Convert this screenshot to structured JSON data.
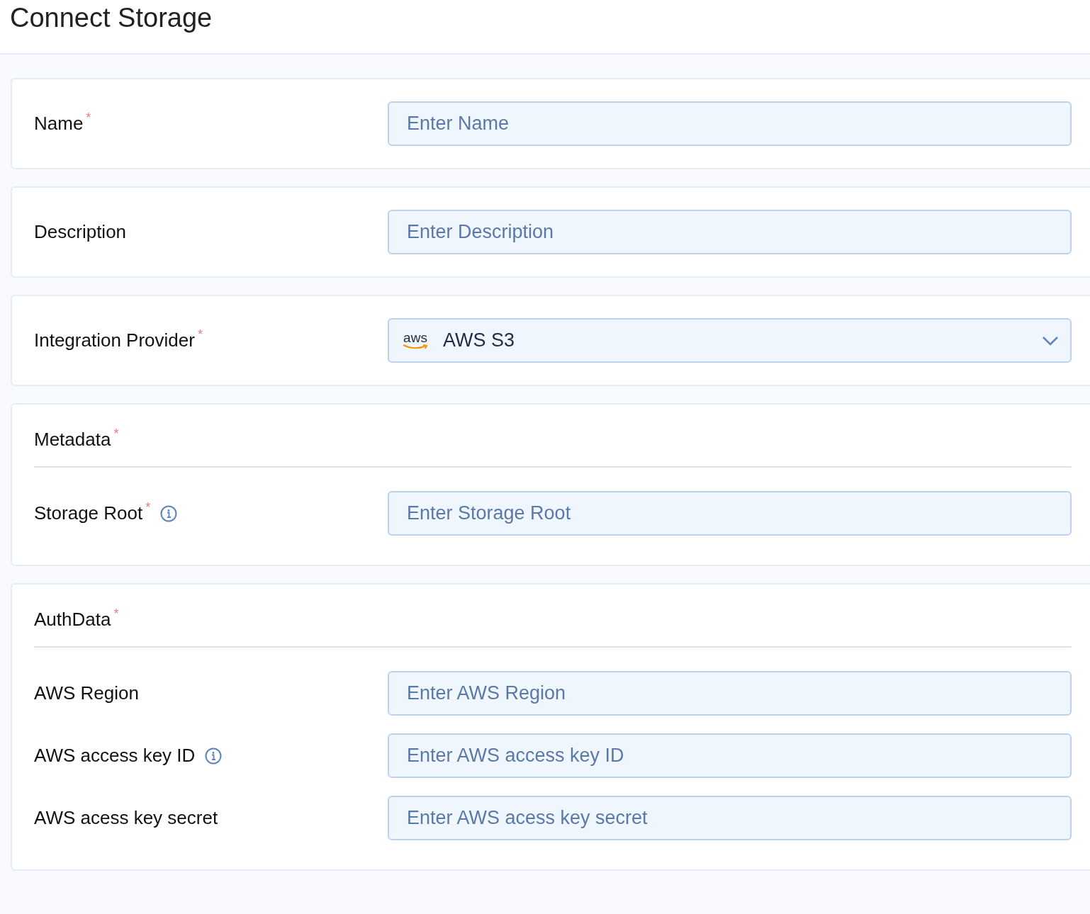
{
  "title": "Connect Storage",
  "sections": [
    {
      "kind": "field",
      "label": "Name",
      "required_mark": "*",
      "info": false,
      "placeholder": "Enter Name"
    },
    {
      "kind": "field",
      "label": "Description",
      "info": false,
      "placeholder": "Enter Description"
    },
    {
      "kind": "select",
      "label": "Integration Provider",
      "required_mark": "*",
      "logo_text": "aws",
      "value": "AWS S3"
    },
    {
      "kind": "group",
      "heading": "Metadata",
      "required_mark": "*",
      "fields": [
        {
          "label": "Storage Root",
          "required_mark": "*",
          "info": true,
          "placeholder": "Enter Storage Root"
        }
      ]
    },
    {
      "kind": "group",
      "heading": "AuthData",
      "required_mark": "*",
      "fields": [
        {
          "label": "AWS Region",
          "info": false,
          "placeholder": "Enter AWS Region"
        },
        {
          "label": "AWS access key ID",
          "info": true,
          "placeholder": "Enter AWS access key ID"
        },
        {
          "label": "AWS acess key secret",
          "info": false,
          "placeholder": "Enter AWS acess key secret"
        }
      ]
    }
  ]
}
